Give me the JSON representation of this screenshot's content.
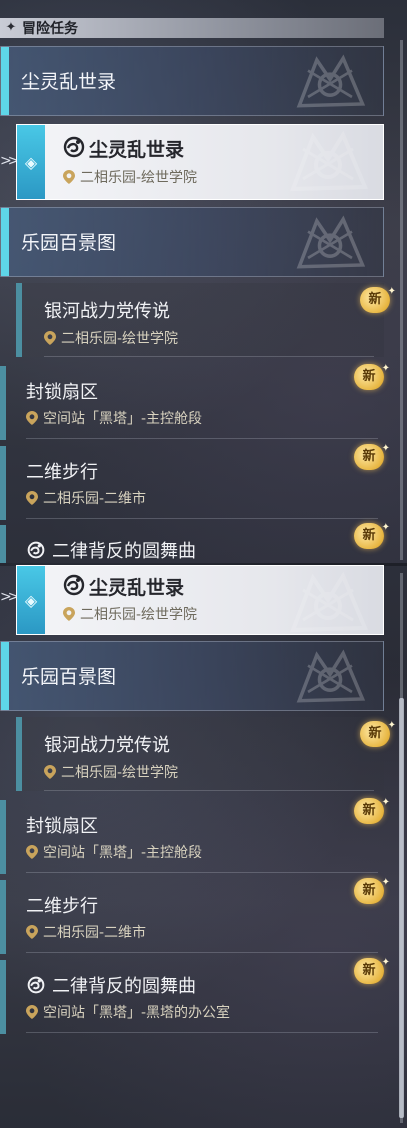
{
  "header": {
    "title": "冒险任务",
    "icon": "diamond-star-icon"
  },
  "colors": {
    "accent_cyan": "#5ed6e8",
    "badge_gold": "#e7b642",
    "location_pin": "#c9a45c"
  },
  "top": {
    "category1": "尘灵乱世录",
    "selected": {
      "title": "尘灵乱世录",
      "location": "二相乐园-绘世学院"
    },
    "category2": "乐园百景图",
    "items": [
      {
        "title": "银河战力党传说",
        "location": "二相乐园-绘世学院",
        "badge": "新"
      },
      {
        "title": "封锁扇区",
        "location": "空间站「黑塔」-主控舱段",
        "badge": "新"
      },
      {
        "title": "二维步行",
        "location": "二相乐园-二维市",
        "badge": "新"
      },
      {
        "title": "二律背反的圆舞曲",
        "badge": "新"
      }
    ]
  },
  "bottom": {
    "selected": {
      "title": "尘灵乱世录",
      "location": "二相乐园-绘世学院"
    },
    "category2": "乐园百景图",
    "items": [
      {
        "title": "银河战力党传说",
        "location": "二相乐园-绘世学院",
        "badge": "新"
      },
      {
        "title": "封锁扇区",
        "location": "空间站「黑塔」-主控舱段",
        "badge": "新"
      },
      {
        "title": "二维步行",
        "location": "二相乐园-二维市",
        "badge": "新"
      },
      {
        "title": "二律背反的圆舞曲",
        "location": "空间站「黑塔」-黑塔的办公室",
        "badge": "新"
      }
    ]
  }
}
